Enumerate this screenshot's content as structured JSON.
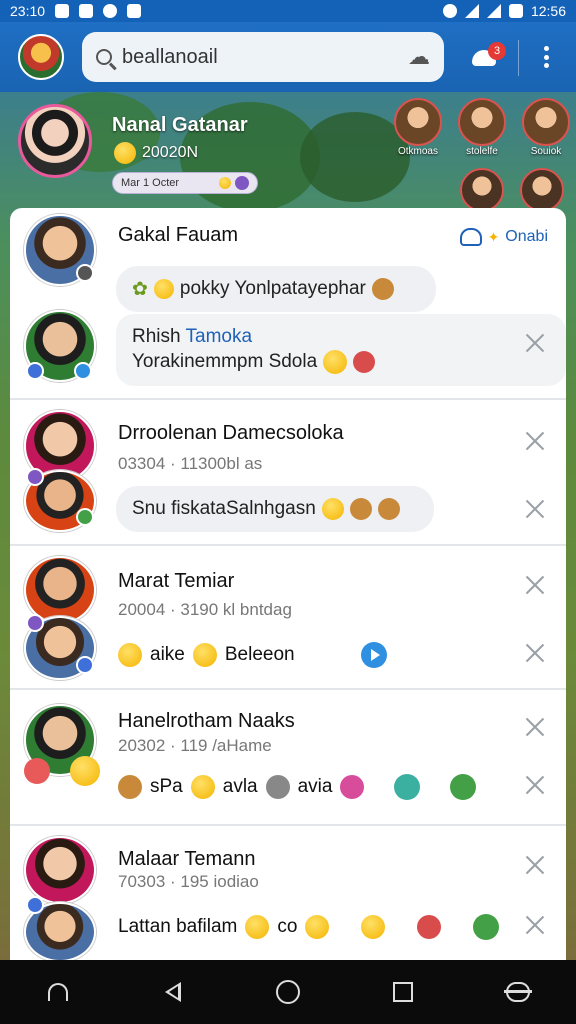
{
  "status_bar": {
    "time_left": "23:10",
    "time_right": "12:56"
  },
  "search": {
    "value": "beallanoail"
  },
  "notifications": {
    "badge": "3"
  },
  "profile": {
    "name": "Nanal Gatanar",
    "meta": "20020N",
    "pill": "Mar 1 Octer"
  },
  "stories": [
    {
      "label": "Otkmoas"
    },
    {
      "label": "stolelfe"
    },
    {
      "label": "Souiok"
    }
  ],
  "chats": [
    {
      "name": "Gakal Fauam",
      "action": "Onabi",
      "bubble": "pokky Yonlpatayephar",
      "sub_name": "Rhish",
      "sub_link": "Tamoka",
      "sub_text": "Yorakinemmpm Sdola"
    },
    {
      "name": "Drroolenan Damecsoloka",
      "sub": "03304 · 11300bl as",
      "bubble": "Snu fiskataSalnhgasn"
    },
    {
      "name": "Marat Temiar",
      "sub": "20004 · 3190 kl bntdag",
      "message": "aike",
      "message2": "Beleeon"
    },
    {
      "name": "Hanelrotham Naaks",
      "sub": "20302 · 119 /aHame",
      "m1": "sPa",
      "m2": "avla",
      "m3": "avia"
    },
    {
      "name": "Malaar Temann",
      "sub": "70303 · 195 iodiao",
      "message": "Lattan bafilam",
      "m2": "co"
    }
  ]
}
